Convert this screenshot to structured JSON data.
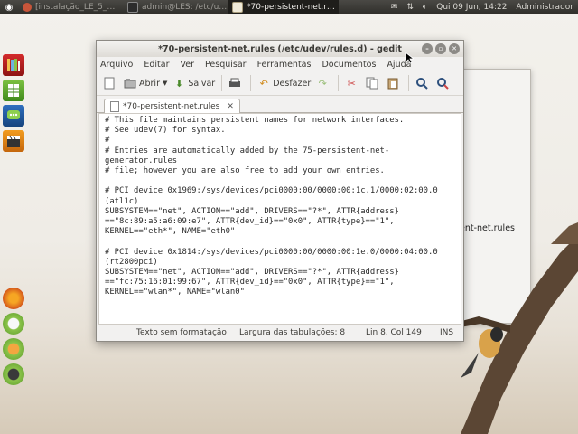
{
  "top_panel": {
    "tasks": [
      {
        "label": "[instalação_LE_5_…",
        "active": false,
        "icon": "browser-icon"
      },
      {
        "label": "admin@LES: /etc/u…",
        "active": false,
        "icon": "terminal-icon"
      },
      {
        "label": "*70-persistent-net.r…",
        "active": true,
        "icon": "text-editor-icon"
      }
    ],
    "clock": "Qui 09 Jun, 14:22",
    "user": "Administrador"
  },
  "launcher": {
    "items": [
      "books-icon",
      "spreadsheet-icon",
      "chat-icon",
      "clapperboard-icon",
      "firefox-icon",
      "document-icon",
      "folder-icon",
      "display-icon"
    ]
  },
  "bg_window": {
    "visible_text": "ent-net.rules"
  },
  "gedit": {
    "title": "*70-persistent-net.rules (/etc/udev/rules.d) - gedit",
    "menu": [
      "Arquivo",
      "Editar",
      "Ver",
      "Pesquisar",
      "Ferramentas",
      "Documentos",
      "Ajuda"
    ],
    "toolbar": {
      "open_label": "Abrir",
      "save_label": "Salvar",
      "undo_label": "Desfazer"
    },
    "tab_label": "*70-persistent-net.rules",
    "content": "# This file maintains persistent names for network interfaces.\n# See udev(7) for syntax.\n#\n# Entries are automatically added by the 75-persistent-net-\ngenerator.rules\n# file; however you are also free to add your own entries.\n\n# PCI device 0x1969:/sys/devices/pci0000:00/0000:00:1c.1/0000:02:00.0\n(atl1c)\nSUBSYSTEM==\"net\", ACTION==\"add\", DRIVERS==\"?*\", ATTR{address}\n==\"8c:89:a5:a6:09:e7\", ATTR{dev_id}==\"0x0\", ATTR{type}==\"1\",\nKERNEL==\"eth*\", NAME=\"eth0\"\n\n# PCI device 0x1814:/sys/devices/pci0000:00/0000:00:1e.0/0000:04:00.0\n(rt2800pci)\nSUBSYSTEM==\"net\", ACTION==\"add\", DRIVERS==\"?*\", ATTR{address}\n==\"fc:75:16:01:99:67\", ATTR{dev_id}==\"0x0\", ATTR{type}==\"1\",\nKERNEL==\"wlan*\", NAME=\"wlan0\"",
    "status": {
      "syntax": "Texto sem formatação",
      "tab_width": "Largura das tabulações:  8",
      "position": "Lin 8, Col 149",
      "mode": "INS"
    }
  }
}
